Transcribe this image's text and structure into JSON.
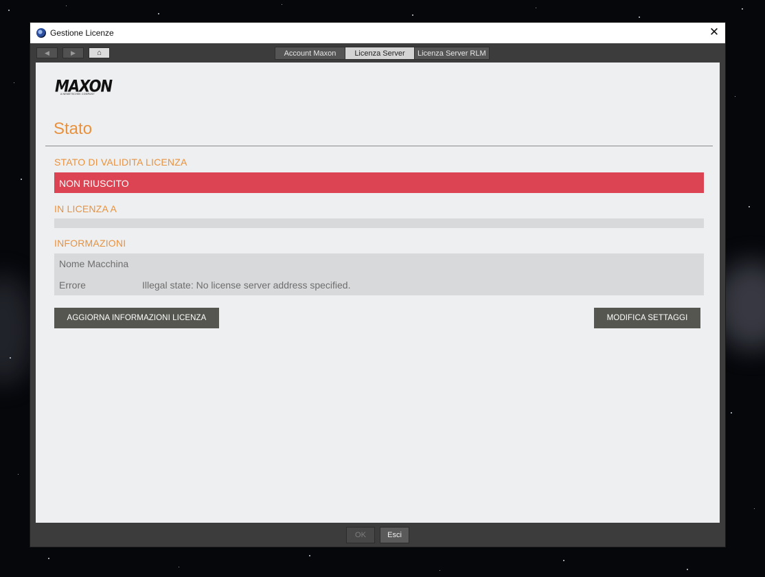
{
  "window": {
    "title": "Gestione Licenze"
  },
  "toolbar": {
    "tabs": [
      {
        "label": "Account Maxon",
        "active": false
      },
      {
        "label": "Licenza Server",
        "active": true
      },
      {
        "label": "Licenza Server RLM",
        "active": false
      }
    ]
  },
  "logo": {
    "word": "MAXON",
    "tagline": "A NEMETSCHEK COMPANY"
  },
  "page": {
    "title": "Stato"
  },
  "validity": {
    "label": "STATO DI VALIDITA LICENZA",
    "status": "NON RIUSCITO",
    "status_color": "#dc4453"
  },
  "licensee": {
    "label": "IN LICENZA A",
    "value": ""
  },
  "info": {
    "label": "INFORMAZIONI",
    "rows": [
      {
        "key": "Nome Macchina",
        "value": ""
      },
      {
        "key": "Errore",
        "value": "Illegal state: No license server address specified."
      }
    ]
  },
  "actions": {
    "refresh": "AGGIORNA INFORMAZIONI LICENZA",
    "modify": "MODIFICA SETTAGGI"
  },
  "footer": {
    "ok": "OK",
    "esc": "Esci"
  },
  "colors": {
    "accent": "#e8923e",
    "error": "#dc4453"
  }
}
